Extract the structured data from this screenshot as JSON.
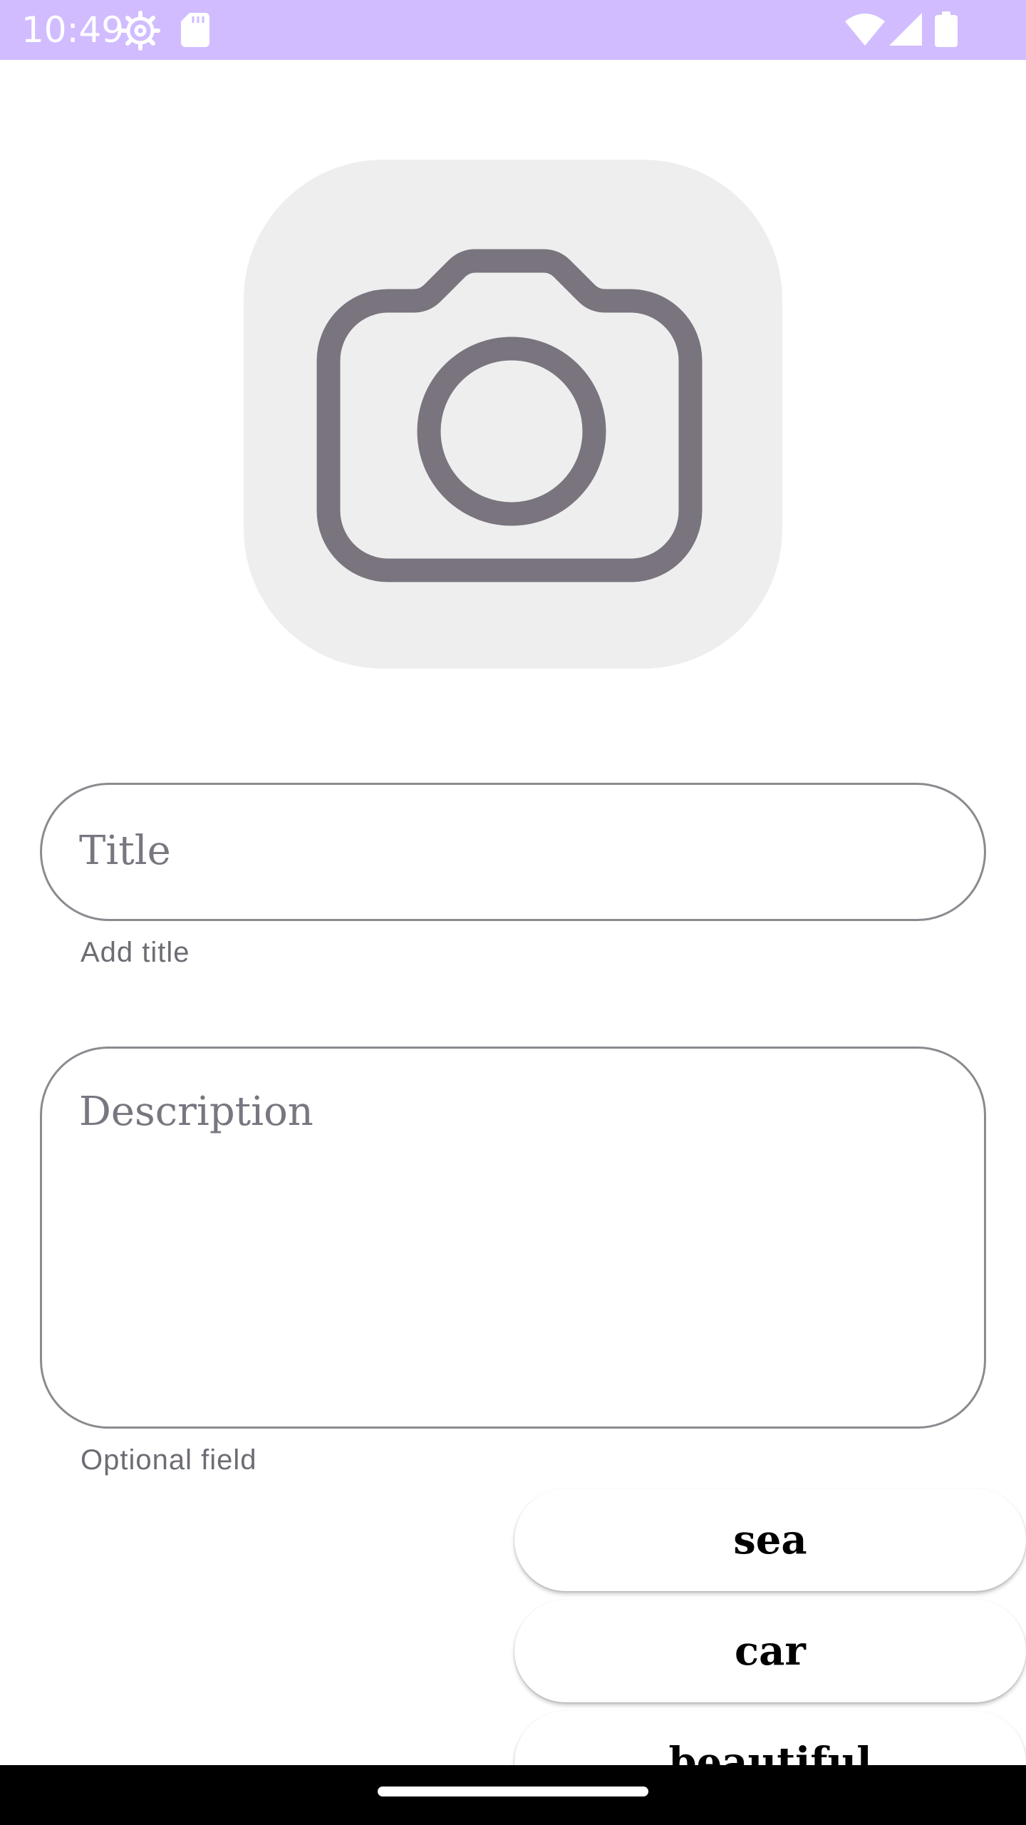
{
  "status_bar": {
    "time": "10:49",
    "background_color": "#d0bcff",
    "icons": [
      "settings-icon",
      "sd-card-icon",
      "wifi-icon",
      "cell-signal-icon",
      "battery-icon"
    ]
  },
  "photo_picker": {
    "icon": "camera-icon",
    "background_color": "#eeeeee",
    "icon_color": "#79747e"
  },
  "title_field": {
    "placeholder": "Title",
    "value": "",
    "helper": "Add title"
  },
  "description_field": {
    "placeholder": "Description",
    "value": "",
    "helper": "Optional field"
  },
  "tags": [
    {
      "label": "sea"
    },
    {
      "label": "car"
    },
    {
      "label": "beautiful"
    }
  ],
  "nav_bar": {
    "background_color": "#000000",
    "handle": "home-gesture-handle"
  }
}
